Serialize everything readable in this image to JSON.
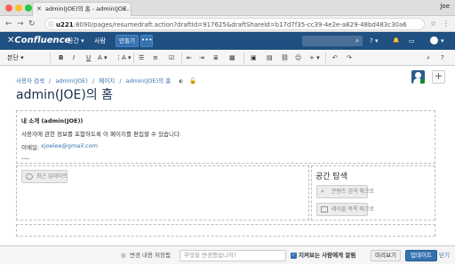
{
  "browser": {
    "tab_title": "admin(JOE)의 홈 - admin(JOE...",
    "tab_close": "×",
    "profile": "Joe",
    "url_host": "u221",
    "url_rest": ":8090/pages/resumedraft.action?draftId=917625&draftShareId=b17d7f35-cc39-4e2e-a829-48bd483c30a6",
    "info_icon": "ⓘ"
  },
  "header": {
    "logo": "Confluence",
    "spaces_label": "공간 ▾",
    "people_label": "사람",
    "create_label": "만들기",
    "more_label": "•••",
    "search_icon": "⌕",
    "help_label": "? ▾",
    "bell_icon": "🔔",
    "inbox_icon": "▭",
    "user_menu": "▾"
  },
  "toolbar": {
    "paragraph": "본단 ▾",
    "bold": "B",
    "italic": "I",
    "underline": "U",
    "color": "A ▾",
    "more_format": "⋮A ▾"
  },
  "breadcrumbs": [
    "사용자 검색",
    "/",
    "admin(JOE)",
    "/",
    "페이지",
    "/",
    "admin(JOE)의 홈"
  ],
  "page": {
    "title": "admin(JOE)의 홈",
    "intro_heading": "내 소개 (admin(JOE))",
    "intro_text": "사용자에 관한 정보를 포함하도록 이 페이지를 편집할 수 있습니다.",
    "email_label": "이메일:",
    "email": "xjoelee@gmail.com",
    "hr_text": "----",
    "macro_recent": "최근 업데이트",
    "space_explore": "공간 탐색",
    "macro_search": "콘텐츠 검색 매크로",
    "macro_labels": "레이블 목록 매크로"
  },
  "bottom": {
    "saved": "변경 내용 저장됨",
    "message_placeholder": "무엇을 변경했습니까?",
    "notify_label": "지켜보는 사람에게 알림",
    "check": "✓",
    "preview": "미리보기",
    "update": "업데이트",
    "close": "닫기"
  }
}
